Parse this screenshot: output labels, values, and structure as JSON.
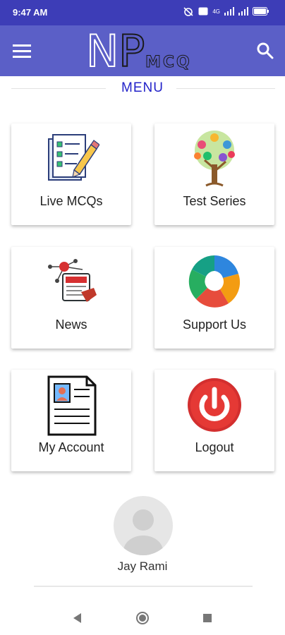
{
  "status_bar": {
    "time": "9:47 AM",
    "icons": [
      "alarm-icon",
      "vo-wifi-icon",
      "signal-4g-icon",
      "signal-icon",
      "battery-icon"
    ],
    "network": "4G"
  },
  "app_bar": {
    "logo_n": "N",
    "logo_p": "P",
    "logo_mcq": "MCQ",
    "menu_icon": "hamburger-icon",
    "search_icon": "search-icon",
    "color": "#5b5fc7"
  },
  "menu": {
    "heading": "MENU",
    "heading_color": "#2323c9",
    "items": [
      {
        "label": "Live MCQs",
        "icon": "checklist-pencil-icon"
      },
      {
        "label": "Test Series",
        "icon": "alphabet-tree-icon"
      },
      {
        "label": "News",
        "icon": "news-network-icon"
      },
      {
        "label": "Support Us",
        "icon": "helping-hands-icon"
      },
      {
        "label": "My Account",
        "icon": "profile-document-icon"
      },
      {
        "label": "Logout",
        "icon": "power-button-icon"
      }
    ]
  },
  "user": {
    "name": "Jay Rami",
    "avatar": "default-avatar-icon"
  },
  "nav_bar": {
    "buttons": [
      "back-icon",
      "home-icon",
      "recents-icon"
    ]
  }
}
